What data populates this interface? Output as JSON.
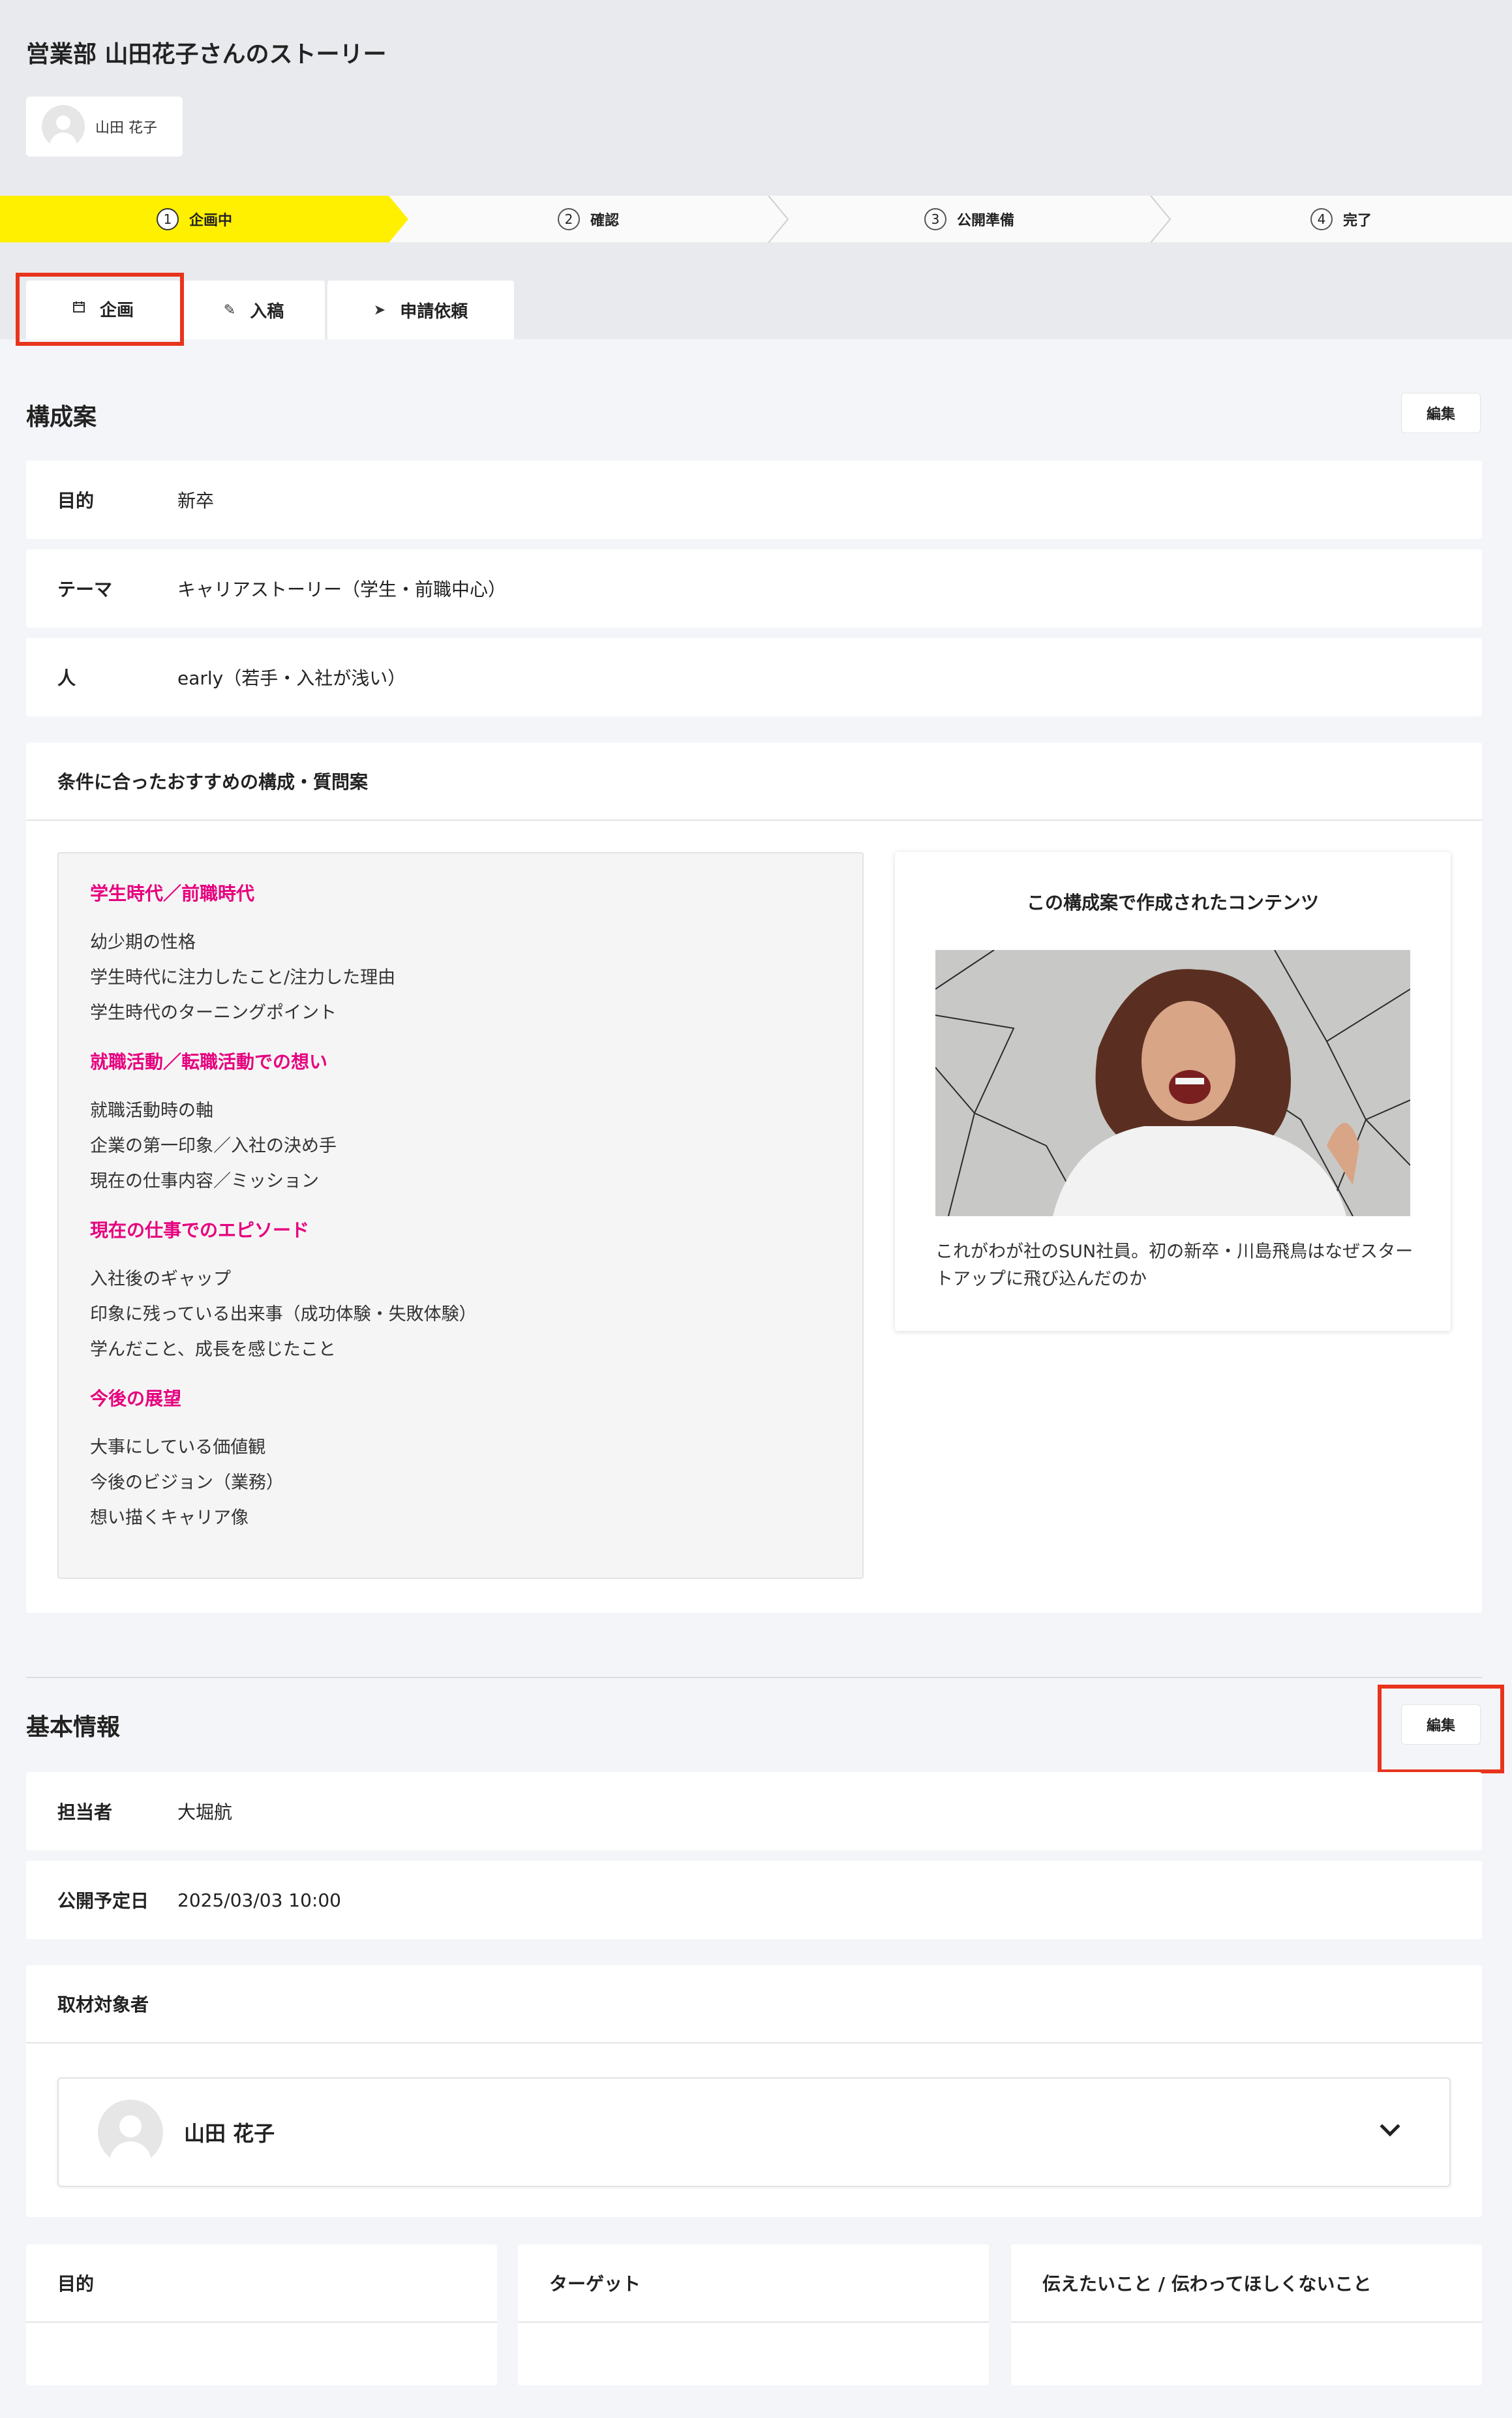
{
  "header": {
    "title": "営業部 山田花子さんのストーリー",
    "user_chip_name": "山田 花子"
  },
  "stepper": {
    "steps": [
      {
        "num": "1",
        "label": "企画中"
      },
      {
        "num": "2",
        "label": "確認"
      },
      {
        "num": "3",
        "label": "公開準備"
      },
      {
        "num": "4",
        "label": "完了"
      }
    ],
    "active_color": "#fff000"
  },
  "tabs": [
    {
      "icon": "calendar-icon",
      "label": "企画"
    },
    {
      "icon": "pencil-icon",
      "label": "入稿"
    },
    {
      "icon": "send-icon",
      "label": "申請依頼"
    }
  ],
  "structure": {
    "title": "構成案",
    "edit_label": "編集",
    "rows": [
      {
        "label": "目的",
        "value": "新卒"
      },
      {
        "label": "テーマ",
        "value": "キャリアストーリー（学生・前職中心）"
      },
      {
        "label": "人",
        "value": "early（若手・入社が浅い）"
      }
    ],
    "recommend_title": "条件に合ったおすすめの構成・質問案",
    "question_groups": [
      {
        "title": "学生時代／前職時代",
        "items": [
          "幼少期の性格",
          "学生時代に注力したこと/注力した理由",
          "学生時代のターニングポイント"
        ]
      },
      {
        "title": "就職活動／転職活動での想い",
        "items": [
          "就職活動時の軸",
          "企業の第一印象／入社の決め手",
          "現在の仕事内容／ミッション"
        ]
      },
      {
        "title": "現在の仕事でのエピソード",
        "items": [
          "入社後のギャップ",
          "印象に残っている出来事（成功体験・失敗体験）",
          "学んだこと、成長を感じたこと"
        ]
      },
      {
        "title": "今後の展望",
        "items": [
          "大事にしている価値観",
          "今後のビジョン（業務）",
          "想い描くキャリア像"
        ]
      }
    ],
    "content_card": {
      "title": "この構成案で作成されたコンテンツ",
      "caption": "これがわが社のSUN社員。初の新卒・川島飛鳥はなぜスタートアップに飛び込んだのか"
    }
  },
  "basic": {
    "title": "基本情報",
    "edit_label": "編集",
    "rows": [
      {
        "label": "担当者",
        "value": "大堀航"
      },
      {
        "label": "公開予定日",
        "value": "2025/03/03 10:00"
      }
    ],
    "interviewee_title": "取材対象者",
    "interviewee_name": "山田 花子",
    "bottom_cards": [
      "目的",
      "ターゲット",
      "伝えたいこと / 伝わってほしくないこと"
    ]
  },
  "colors": {
    "accent_magenta": "#e6007e",
    "annotation_red": "#e8341c",
    "stepper_active": "#fff000"
  }
}
